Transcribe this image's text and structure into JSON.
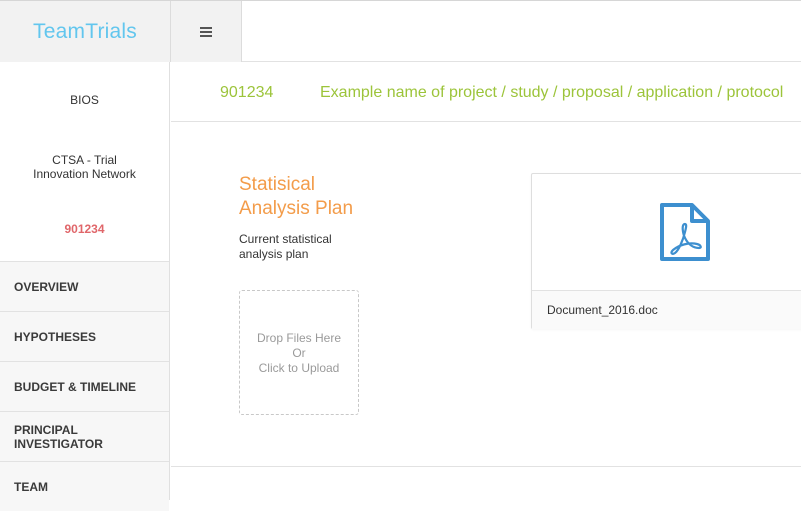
{
  "app": {
    "logo": "TeamTrials",
    "menu_icon": "hamburger-menu-icon"
  },
  "sidebar": {
    "department": "BIOS",
    "program_line1": "CTSA - Trial",
    "program_line2": "Innovation Network",
    "project_id": "901234",
    "project_id_color": "#e0666a",
    "nav_items": [
      {
        "label": "OVERVIEW"
      },
      {
        "label": "HYPOTHESES"
      },
      {
        "label": "BUDGET & TIMELINE"
      },
      {
        "label": "PRINCIPAL INVESTIGATOR"
      },
      {
        "label": "TEAM"
      }
    ]
  },
  "header": {
    "project_id": "901234",
    "project_name": "Example name of project / study / proposal / application / protocol",
    "accent_color": "#9cc43a"
  },
  "section": {
    "title_line1": "Statisical",
    "title_line2": "Analysis Plan",
    "title_color": "#f39c4a",
    "desc_line1": "Current statistical",
    "desc_line2": "analysis plan"
  },
  "dropzone": {
    "line1": "Drop Files Here",
    "line2": "Or",
    "line3": "Click to Upload"
  },
  "file": {
    "name": "Document_2016.doc",
    "icon": "pdf-file-icon",
    "icon_color": "#3d8fcf"
  }
}
